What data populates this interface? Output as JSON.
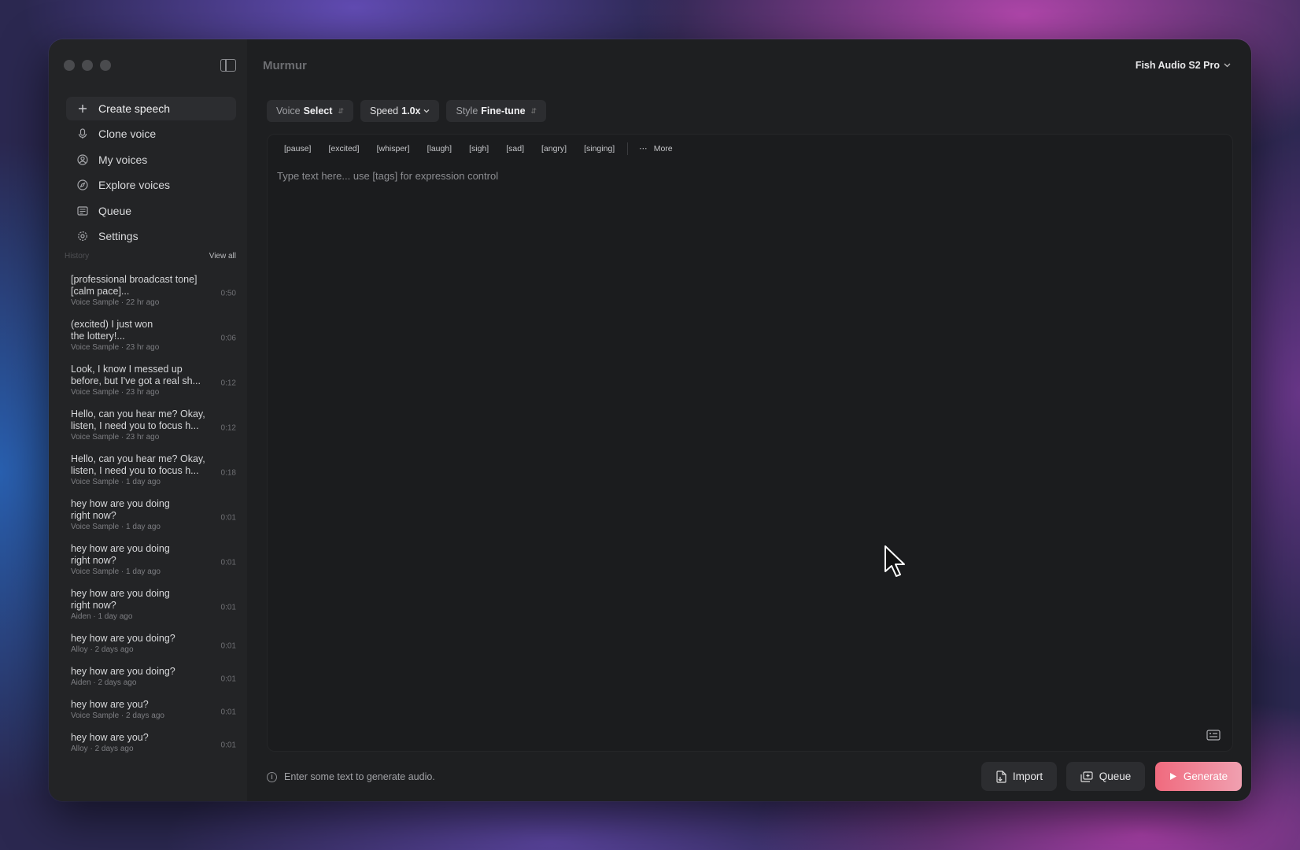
{
  "app": {
    "title": "Murmur",
    "model": "Fish Audio S2 Pro"
  },
  "nav": [
    {
      "label": "Create speech",
      "icon": "plus-icon"
    },
    {
      "label": "Clone voice",
      "icon": "mic-icon"
    },
    {
      "label": "My voices",
      "icon": "user-circle-icon"
    },
    {
      "label": "Explore voices",
      "icon": "compass-icon"
    },
    {
      "label": "Queue",
      "icon": "list-icon"
    },
    {
      "label": "Settings",
      "icon": "gear-icon"
    }
  ],
  "history": {
    "heading": "History",
    "view_all": "View all",
    "items": [
      {
        "text": "[professional broadcast tone]\n[calm pace]...",
        "voice": "Voice Sample",
        "time": "22 hr ago",
        "duration": "0:50"
      },
      {
        "text": "(excited) I just won\nthe lottery!...",
        "voice": "Voice Sample",
        "time": "23 hr ago",
        "duration": "0:06"
      },
      {
        "text": "Look, I know I messed up\nbefore, but I've got a real sh...",
        "voice": "Voice Sample",
        "time": "23 hr ago",
        "duration": "0:12"
      },
      {
        "text": "Hello, can you hear me? Okay,\nlisten, I need you to focus h...",
        "voice": "Voice Sample",
        "time": "23 hr ago",
        "duration": "0:12"
      },
      {
        "text": "Hello, can you hear me? Okay,\nlisten, I need you to focus h...",
        "voice": "Voice Sample",
        "time": "1 day ago",
        "duration": "0:18"
      },
      {
        "text": "hey how are you doing\nright now?",
        "voice": "Voice Sample",
        "time": "1 day ago",
        "duration": "0:01"
      },
      {
        "text": "hey how are you doing\nright now?",
        "voice": "Voice Sample",
        "time": "1 day ago",
        "duration": "0:01"
      },
      {
        "text": "hey how are you doing\nright now?",
        "voice": "Aiden",
        "time": "1 day ago",
        "duration": "0:01"
      },
      {
        "text": "hey how are you doing?",
        "voice": "Alloy",
        "time": "2 days ago",
        "duration": "0:01"
      },
      {
        "text": "hey how are you doing?",
        "voice": "Aiden",
        "time": "2 days ago",
        "duration": "0:01"
      },
      {
        "text": "hey how are you?",
        "voice": "Voice Sample",
        "time": "2 days ago",
        "duration": "0:01"
      },
      {
        "text": "hey how are you?",
        "voice": "Alloy",
        "time": "2 days ago",
        "duration": "0:01"
      }
    ]
  },
  "controls": {
    "voice": {
      "label": "Voice",
      "value": "Select"
    },
    "speed": {
      "label": "Speed",
      "value": "1.0x"
    },
    "style": {
      "label": "Style",
      "value": "Fine-tune"
    }
  },
  "tags": [
    "[pause]",
    "[excited]",
    "[whisper]",
    "[laugh]",
    "[sigh]",
    "[sad]",
    "[angry]",
    "[singing]"
  ],
  "more_label": "More",
  "editor": {
    "placeholder": "Type text here... use [tags] for expression control"
  },
  "footer": {
    "hint": "Enter some text to generate audio.",
    "import_label": "Import",
    "queue_label": "Queue",
    "generate_label": "Generate"
  }
}
